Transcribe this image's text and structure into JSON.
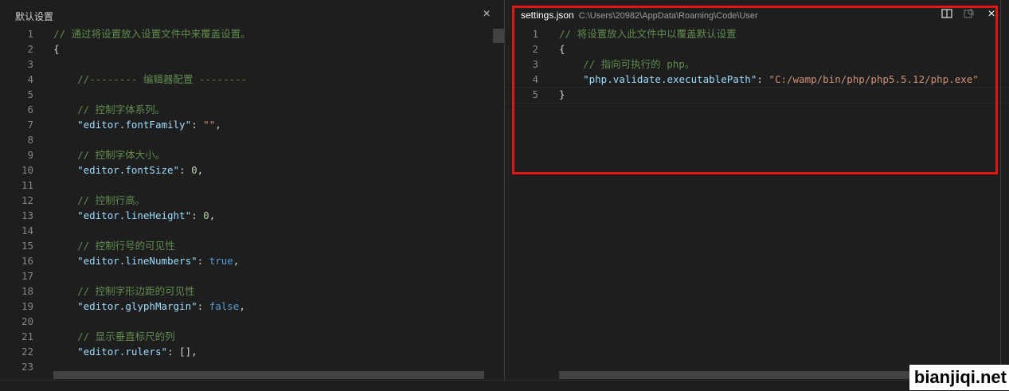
{
  "left": {
    "title": "默认设置",
    "close_icon": "×",
    "lines": [
      {
        "n": "1",
        "parts": [
          [
            "c",
            "// 通过将设置放入设置文件中来覆盖设置。"
          ]
        ]
      },
      {
        "n": "2",
        "parts": [
          [
            "p",
            "{"
          ]
        ]
      },
      {
        "n": "3",
        "parts": []
      },
      {
        "n": "4",
        "parts": [
          [
            "c",
            "    //-------- 编辑器配置 --------"
          ]
        ]
      },
      {
        "n": "5",
        "parts": []
      },
      {
        "n": "6",
        "parts": [
          [
            "c",
            "    // 控制字体系列。"
          ]
        ]
      },
      {
        "n": "7",
        "parts": [
          [
            "p",
            "    "
          ],
          [
            "k",
            "\"editor.fontFamily\""
          ],
          [
            "p",
            ": "
          ],
          [
            "s",
            "\"\""
          ],
          [
            "p",
            ","
          ]
        ]
      },
      {
        "n": "8",
        "parts": []
      },
      {
        "n": "9",
        "parts": [
          [
            "c",
            "    // 控制字体大小。"
          ]
        ]
      },
      {
        "n": "10",
        "parts": [
          [
            "p",
            "    "
          ],
          [
            "k",
            "\"editor.fontSize\""
          ],
          [
            "p",
            ": "
          ],
          [
            "n",
            "0"
          ],
          [
            "p",
            ","
          ]
        ]
      },
      {
        "n": "11",
        "parts": []
      },
      {
        "n": "12",
        "parts": [
          [
            "c",
            "    // 控制行高。"
          ]
        ]
      },
      {
        "n": "13",
        "parts": [
          [
            "p",
            "    "
          ],
          [
            "k",
            "\"editor.lineHeight\""
          ],
          [
            "p",
            ": "
          ],
          [
            "n",
            "0"
          ],
          [
            "p",
            ","
          ]
        ]
      },
      {
        "n": "14",
        "parts": []
      },
      {
        "n": "15",
        "parts": [
          [
            "c",
            "    // 控制行号的可见性"
          ]
        ]
      },
      {
        "n": "16",
        "parts": [
          [
            "p",
            "    "
          ],
          [
            "k",
            "\"editor.lineNumbers\""
          ],
          [
            "p",
            ": "
          ],
          [
            "b",
            "true"
          ],
          [
            "p",
            ","
          ]
        ]
      },
      {
        "n": "17",
        "parts": []
      },
      {
        "n": "18",
        "parts": [
          [
            "c",
            "    // 控制字形边距的可见性"
          ]
        ]
      },
      {
        "n": "19",
        "parts": [
          [
            "p",
            "    "
          ],
          [
            "k",
            "\"editor.glyphMargin\""
          ],
          [
            "p",
            ": "
          ],
          [
            "b",
            "false"
          ],
          [
            "p",
            ","
          ]
        ]
      },
      {
        "n": "20",
        "parts": []
      },
      {
        "n": "21",
        "parts": [
          [
            "c",
            "    // 显示垂直标尺的列"
          ]
        ]
      },
      {
        "n": "22",
        "parts": [
          [
            "p",
            "    "
          ],
          [
            "k",
            "\"editor.rulers\""
          ],
          [
            "p",
            ": [],"
          ]
        ]
      },
      {
        "n": "23",
        "parts": []
      }
    ]
  },
  "right": {
    "title": "settings.json",
    "path": "C:\\Users\\20982\\AppData\\Roaming\\Code\\User",
    "split_icon": "split-editor-icon",
    "open_icon": "open-changes-icon",
    "close_icon": "×",
    "lines": [
      {
        "n": "1",
        "parts": [
          [
            "c",
            "// 将设置放入此文件中以覆盖默认设置"
          ]
        ]
      },
      {
        "n": "2",
        "parts": [
          [
            "p",
            "{"
          ]
        ]
      },
      {
        "n": "3",
        "parts": [
          [
            "c",
            "    // 指向可执行的 php。"
          ]
        ]
      },
      {
        "n": "4",
        "parts": [
          [
            "p",
            "    "
          ],
          [
            "k",
            "\"php.validate.executablePath\""
          ],
          [
            "p",
            ": "
          ],
          [
            "s",
            "\"C:/wamp/bin/php/php5.5.12/php.exe\""
          ]
        ]
      },
      {
        "n": "5",
        "parts": [
          [
            "p",
            "}"
          ]
        ]
      }
    ]
  },
  "watermark": "bianjiqi.net"
}
